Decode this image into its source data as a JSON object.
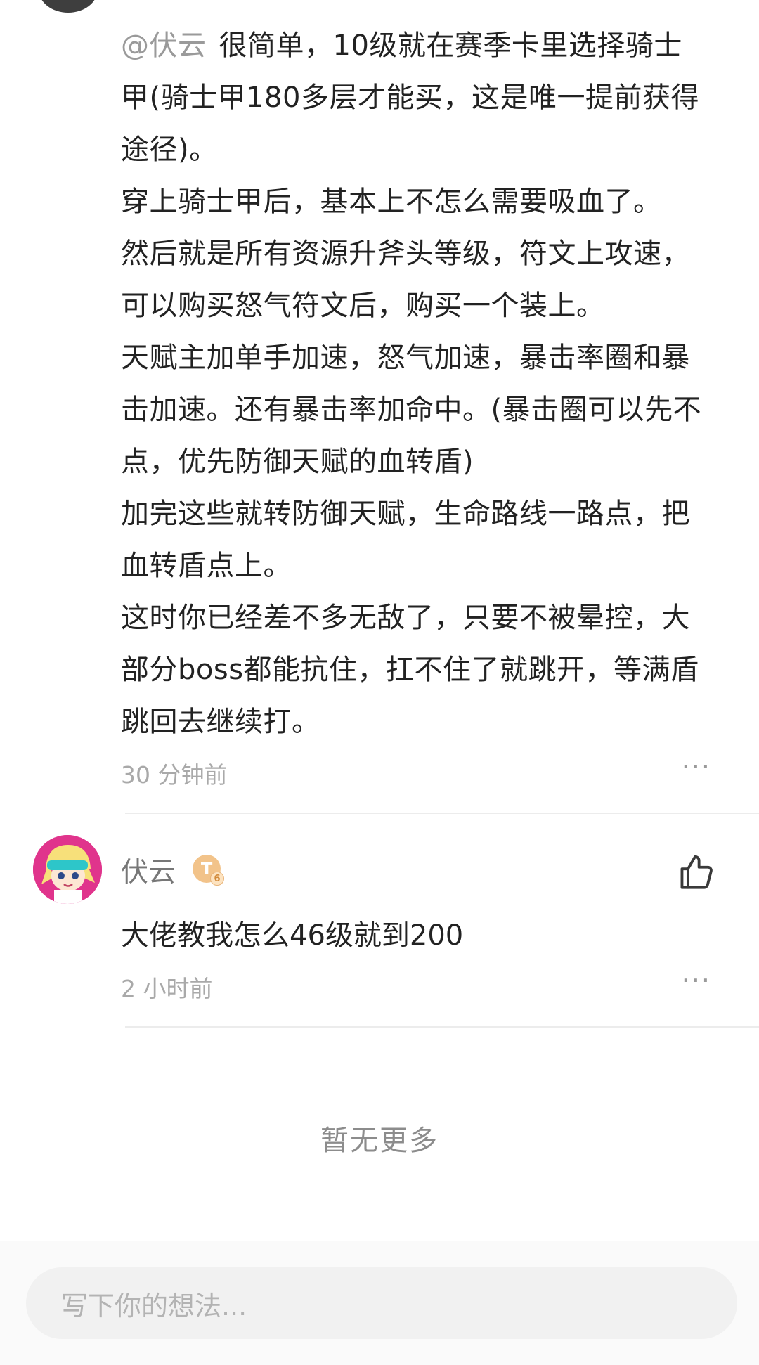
{
  "reply": {
    "mention": "@伏云",
    "lines": [
      "很简单，10级就在赛季卡里选择骑士",
      "甲(骑士甲180多层才能买，这是唯一提前获得",
      "途径)。",
      "穿上骑士甲后，基本上不怎么需要吸血了。",
      "然后就是所有资源升斧头等级，符文上攻速，",
      "可以购买怒气符文后，购买一个装上。",
      "天赋主加单手加速，怒气加速，暴击率圈和暴",
      "击加速。还有暴击率加命中。(暴击圈可以先不",
      "点，优先防御天赋的血转盾)",
      "加完这些就转防御天赋，生命路线一路点，把",
      "血转盾点上。",
      "这时你已经差不多无敌了，只要不被晕控，大",
      "部分boss都能抗住，扛不住了就跳开，等满盾",
      "跳回去继续打。"
    ],
    "time": "30 分钟前",
    "more": "···"
  },
  "comment": {
    "username": "伏云",
    "badge": "T",
    "badge_level": "6",
    "text": "大佬教我怎么46级就到200",
    "time": "2 小时前",
    "more": "···"
  },
  "footer": {
    "no_more": "暂无更多",
    "input_placeholder": "写下你的想法..."
  },
  "colors": {
    "text": "#222222",
    "muted": "#a9a9a9",
    "divider": "#ececec",
    "avatar_bg": "#e0348c",
    "badge": "#f2c38a"
  }
}
